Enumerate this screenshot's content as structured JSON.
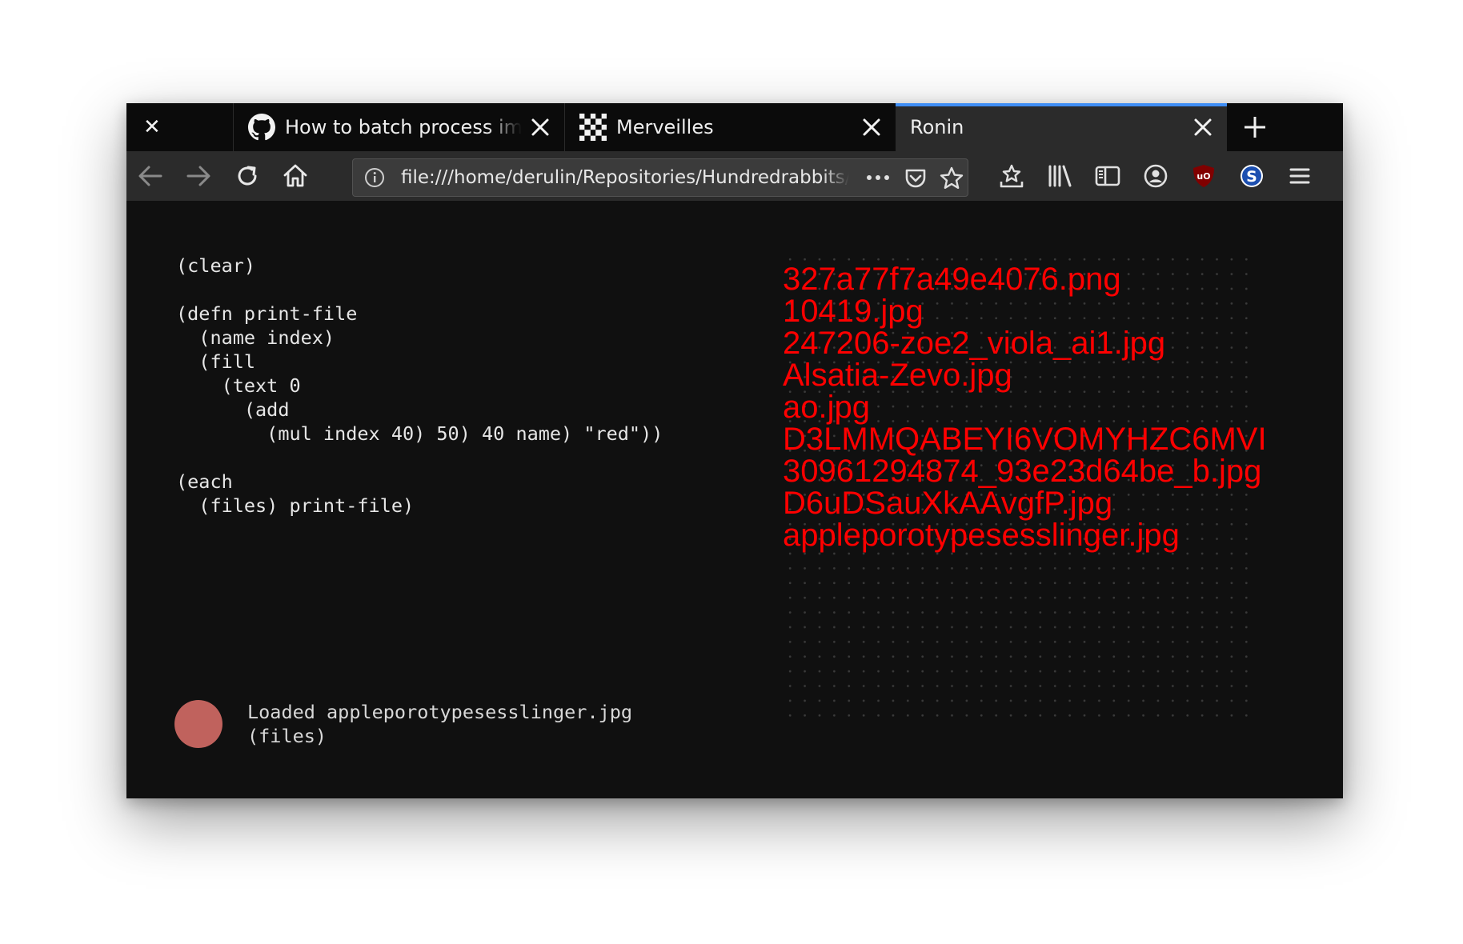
{
  "tabs": [
    {
      "title": "How to batch process ima",
      "icon": "github-icon",
      "active": false
    },
    {
      "title": "Merveilles",
      "icon": "merveilles-icon",
      "active": false
    },
    {
      "title": "Ronin",
      "icon": "",
      "active": true
    }
  ],
  "window": {
    "close_glyph": "✕"
  },
  "toolbar": {
    "url": "file:///home/derulin/Repositories/Hundredrabbits/"
  },
  "editor": {
    "code": "(clear)\n\n(defn print-file\n  (name index)\n  (fill\n    (text 0\n      (add\n        (mul index 40) 50) 40 name) \"red\"))\n\n(each\n  (files) print-file)"
  },
  "canvas": {
    "files": [
      "327a77f7a49e4076.png",
      "10419.jpg",
      "247206-zoe2_viola_ai1.jpg",
      "Alsatia-Zevo.jpg",
      "ao.jpg",
      "D3LMMQABEYI6VOMYHZC6MVI",
      "30961294874_93e23d64be_b.jpg",
      "D6uDSauXkAAvgfP.jpg",
      "appleporotypesesslinger.jpg"
    ],
    "text_color": "#ff0000"
  },
  "status": {
    "line1": "Loaded appleporotypesesslinger.jpg",
    "line2": "(files)",
    "indicator_color": "#c0625d"
  },
  "colors": {
    "background": "#101010",
    "tab_active_accent": "#3f8ef5"
  }
}
